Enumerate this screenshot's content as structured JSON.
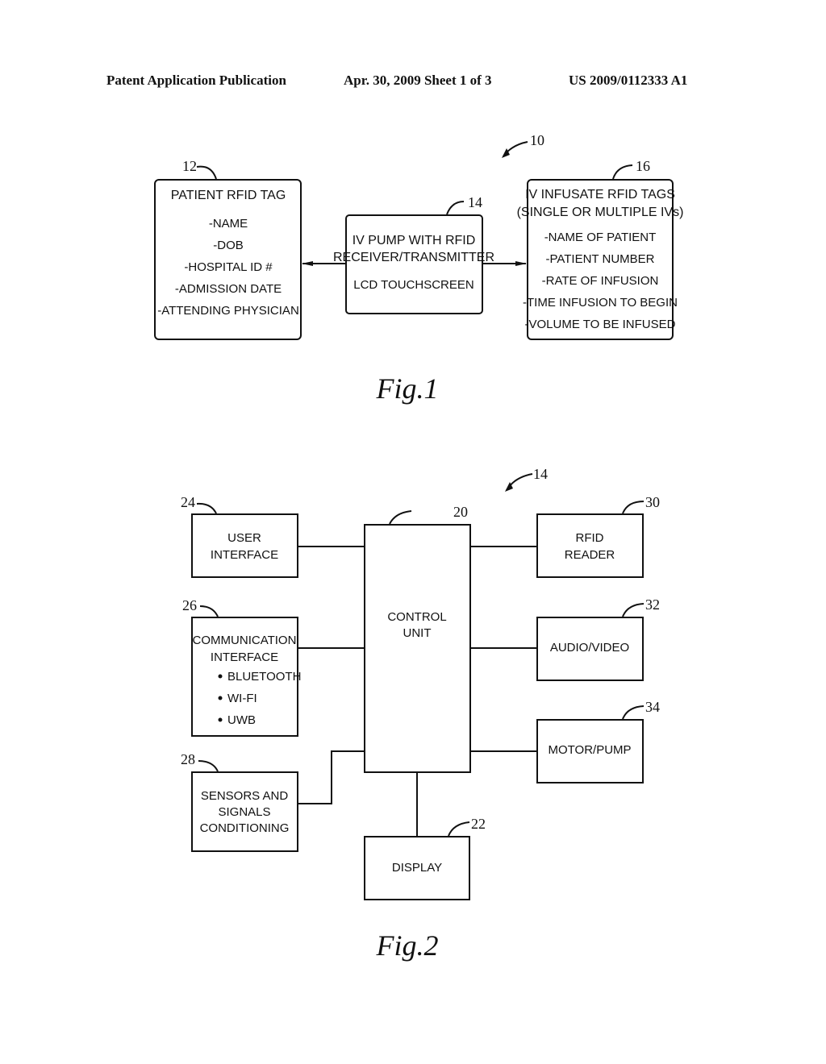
{
  "header": {
    "left": "Patent Application Publication",
    "center": "Apr. 30, 2009  Sheet 1 of 3",
    "right": "US 2009/0112333 A1"
  },
  "fig1": {
    "caption": "Fig.1",
    "system_ref": "10",
    "patient_tag": {
      "ref": "12",
      "title": "PATIENT RFID TAG",
      "items": [
        "-NAME",
        "-DOB",
        "-HOSPITAL ID #",
        "-ADMISSION DATE",
        "-ATTENDING PHYSICIAN"
      ]
    },
    "pump": {
      "ref": "14",
      "lines": [
        "IV PUMP WITH RFID",
        "RECEIVER/TRANSMITTER",
        "LCD TOUCHSCREEN"
      ]
    },
    "infusate_tags": {
      "ref": "16",
      "title_lines": [
        "IV INFUSATE RFID TAGS",
        "(SINGLE OR MULTIPLE IVs)"
      ],
      "items": [
        "-NAME OF PATIENT",
        "-PATIENT NUMBER",
        "-RATE OF INFUSION",
        "-TIME INFUSION TO BEGIN",
        "-VOLUME TO BE INFUSED"
      ]
    }
  },
  "fig2": {
    "caption": "Fig.2",
    "system_ref": "14",
    "control_unit": {
      "ref": "20",
      "lines": [
        "CONTROL",
        "UNIT"
      ]
    },
    "display": {
      "ref": "22",
      "lines": [
        "DISPLAY"
      ]
    },
    "user_interface": {
      "ref": "24",
      "lines": [
        "USER",
        "INTERFACE"
      ]
    },
    "communication": {
      "ref": "26",
      "lines": [
        "COMMUNICATION",
        "INTERFACE"
      ],
      "bullets": [
        "BLUETOOTH",
        "WI-FI",
        "UWB"
      ]
    },
    "sensors": {
      "ref": "28",
      "lines": [
        "SENSORS AND",
        "SIGNALS",
        "CONDITIONING"
      ]
    },
    "rfid_reader": {
      "ref": "30",
      "lines": [
        "RFID",
        "READER"
      ]
    },
    "audio_video": {
      "ref": "32",
      "lines": [
        "AUDIO/VIDEO"
      ]
    },
    "motor_pump": {
      "ref": "34",
      "lines": [
        "MOTOR/PUMP"
      ]
    }
  }
}
